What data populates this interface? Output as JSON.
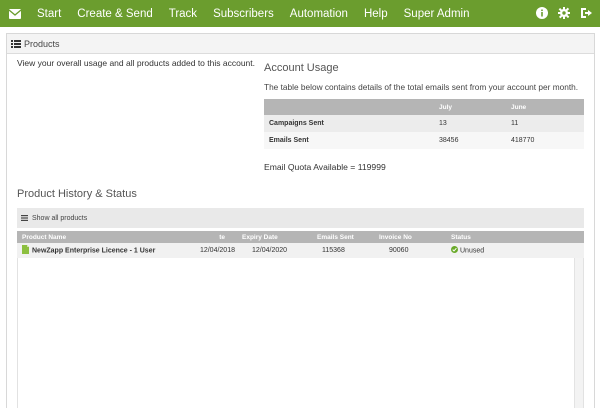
{
  "nav": {
    "items": [
      "Start",
      "Create & Send",
      "Track",
      "Subscribers",
      "Automation",
      "Help",
      "Super Admin"
    ],
    "icons": [
      "info-icon",
      "gear-icon",
      "logout-icon"
    ]
  },
  "panel": {
    "title": "Products"
  },
  "overview_text": "View your overall usage and all products added to this account.",
  "usage": {
    "title": "Account Usage",
    "description": "The table below contains details of the total emails sent from your account per month.",
    "columns": [
      "",
      "July",
      "June"
    ],
    "rows": [
      {
        "label": "Campaigns Sent",
        "july": "13",
        "june": "11"
      },
      {
        "label": "Emails Sent",
        "july": "38456",
        "june": "418770"
      }
    ],
    "quota": "Email Quota Available = 119999"
  },
  "history": {
    "title": "Product History & Status",
    "show_all": "Show all products",
    "columns": [
      "Product Name",
      "te",
      "Expiry Date",
      "Emails Sent",
      "Invoice No",
      "Status"
    ],
    "rows": [
      {
        "name": "NewZapp Enterprise Licence - 1 User",
        "date": "12/04/2018",
        "expiry": "12/04/2020",
        "emails": "115368",
        "invoice": "90060",
        "status": "Unused"
      }
    ]
  },
  "colors": {
    "nav_bg": "#6b9d2e",
    "header_bg": "#b5b5b5",
    "status_ok": "#6aaa2a"
  }
}
